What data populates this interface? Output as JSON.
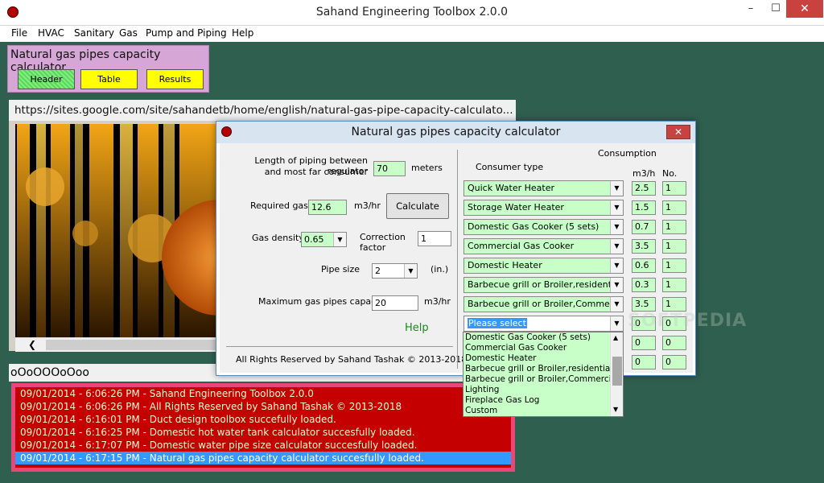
{
  "window": {
    "title": "Sahand Engineering Toolbox 2.0.0",
    "minimize": "–",
    "maximize": "☐",
    "close": "✕"
  },
  "menu": [
    "File",
    "HVAC",
    "Sanitary",
    "Gas",
    "Pump and Piping",
    "Help"
  ],
  "panel": {
    "title": "Natural gas pipes capacity calculator",
    "buttons": [
      "Header",
      "Table",
      "Results"
    ]
  },
  "url": "https://sites.google.com/site/sahandetb/home/english/natural-gas-pipe-capacity-calculato...",
  "marquee": "oOoOOOoOoo",
  "log": [
    "09/01/2014 - 6:06:26 PM - Sahand Engineering Toolbox 2.0.0",
    "09/01/2014 - 6:06:26 PM - All Rights Reserved by Sahand Tashak © 2013-2018",
    "09/01/2014 - 6:16:01 PM - Duct design toolbox succefully loaded.",
    "09/01/2014 - 6:16:25 PM - Domestic hot water tank calculator succesfully loaded.",
    "09/01/2014 - 6:17:07 PM - Domestic water pipe size calculator succesfully loaded.",
    "09/01/2014 - 6:17:15 PM - Natural gas pipes capacity calculator succesfully loaded."
  ],
  "dialog": {
    "title": "Natural gas pipes capacity calculator",
    "close": "✕",
    "length_label_1": "Length of piping between regulator",
    "length_label_2": "and most far consumer",
    "length_value": "70",
    "length_unit": "meters",
    "required_label": "Required gas",
    "required_value": "12.6",
    "required_unit": "m3/hr",
    "calculate": "Calculate",
    "density_label": "Gas density",
    "density_value": "0.65",
    "correction_label_1": "Correction",
    "correction_label_2": "factor",
    "correction_value": "1",
    "pipe_label": "Pipe size",
    "pipe_value": "2",
    "pipe_unit": "(in.)",
    "max_label": "Maximum gas pipes capacity",
    "max_value": "20",
    "max_unit": "m3/hr",
    "help": "Help",
    "copyright": "All Rights Reserved by Sahand Tashak © 2013-2018",
    "consumption_header": "Consumption",
    "consumer_type_header": "Consumer type",
    "m3h_header": "m3/h",
    "no_header": "No.",
    "consumers": [
      {
        "type": "Quick Water Heater",
        "m3h": "2.5",
        "no": "1"
      },
      {
        "type": "Storage Water Heater",
        "m3h": "1.5",
        "no": "1"
      },
      {
        "type": "Domestic Gas Cooker (5 sets)",
        "m3h": "0.7",
        "no": "1"
      },
      {
        "type": "Commercial Gas Cooker",
        "m3h": "3.5",
        "no": "1"
      },
      {
        "type": "Domestic Heater",
        "m3h": "0.6",
        "no": "1"
      },
      {
        "type": "Barbecue grill or Broiler,residential",
        "m3h": "0.3",
        "no": "1"
      },
      {
        "type": "Barbecue grill or Broiler,Commercial",
        "m3h": "3.5",
        "no": "1"
      },
      {
        "type": "Please select",
        "m3h": "0",
        "no": "0"
      }
    ],
    "extra_rows": [
      {
        "m3h": "0",
        "no": "0"
      },
      {
        "m3h": "0",
        "no": "0"
      }
    ],
    "dropdown_options": [
      "Domestic Gas Cooker (5 sets)",
      "Commercial Gas Cooker",
      "Domestic Heater",
      "Barbecue grill or Broiler,residential",
      "Barbecue grill or Broiler,Commercial",
      "Lighting",
      "Fireplace Gas Log",
      "Custom"
    ]
  },
  "colors": {
    "desktop": "#2f5f4f",
    "panel": "#d6a6d6",
    "yellow_btn": "#ffff00",
    "header_btn": "#6fe36f",
    "log_bg": "#c40000",
    "log_border": "#e9477a",
    "input_green": "#c8ffc8",
    "help_link": "#1a8a1a"
  }
}
